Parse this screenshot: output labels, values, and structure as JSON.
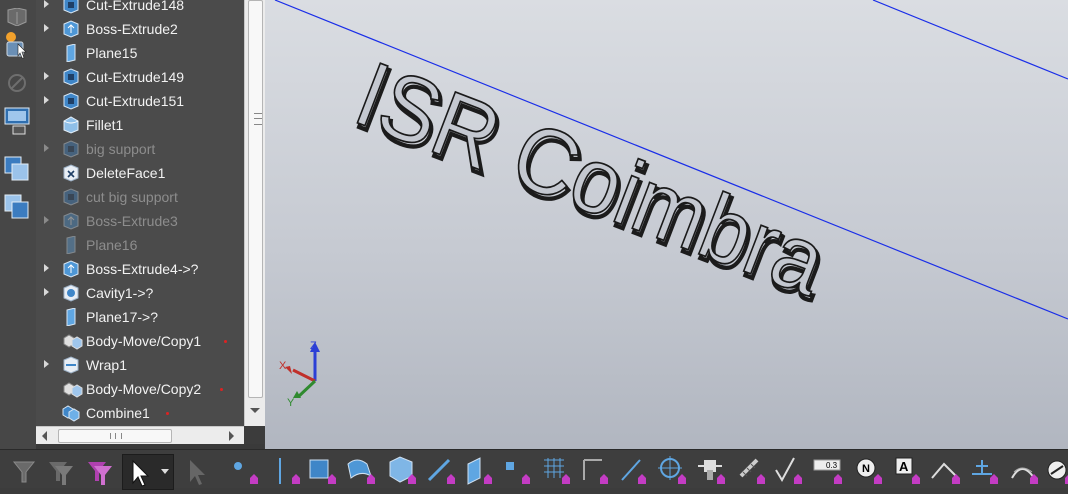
{
  "feature_tree": {
    "items": [
      {
        "label": "Cut-Extrude148",
        "icon": "cut-extrude-icon",
        "expandable": true,
        "dim": false,
        "marker": false
      },
      {
        "label": "Boss-Extrude2",
        "icon": "boss-extrude-icon",
        "expandable": true,
        "dim": false,
        "marker": false
      },
      {
        "label": "Plane15",
        "icon": "plane-icon",
        "expandable": false,
        "dim": false,
        "marker": false
      },
      {
        "label": "Cut-Extrude149",
        "icon": "cut-extrude-icon",
        "expandable": true,
        "dim": false,
        "marker": false
      },
      {
        "label": "Cut-Extrude151",
        "icon": "cut-extrude-icon",
        "expandable": true,
        "dim": false,
        "marker": false
      },
      {
        "label": "Fillet1",
        "icon": "fillet-icon",
        "expandable": false,
        "dim": false,
        "marker": false
      },
      {
        "label": "big support",
        "icon": "cut-extrude-icon",
        "expandable": true,
        "dim": true,
        "marker": false
      },
      {
        "label": "DeleteFace1",
        "icon": "delete-face-icon",
        "expandable": false,
        "dim": false,
        "marker": false
      },
      {
        "label": "cut big support",
        "icon": "cut-extrude-icon",
        "expandable": false,
        "dim": true,
        "marker": false
      },
      {
        "label": "Boss-Extrude3",
        "icon": "boss-extrude-icon",
        "expandable": true,
        "dim": true,
        "marker": false
      },
      {
        "label": "Plane16",
        "icon": "plane-icon",
        "expandable": false,
        "dim": true,
        "marker": false
      },
      {
        "label": "Boss-Extrude4->?",
        "icon": "boss-extrude-icon",
        "expandable": true,
        "dim": false,
        "marker": false
      },
      {
        "label": "Cavity1->?",
        "icon": "cavity-icon",
        "expandable": true,
        "dim": false,
        "marker": false
      },
      {
        "label": "Plane17->?",
        "icon": "plane-icon",
        "expandable": false,
        "dim": false,
        "marker": false
      },
      {
        "label": "Body-Move/Copy1",
        "icon": "body-move-icon",
        "expandable": false,
        "dim": false,
        "marker": true
      },
      {
        "label": "Wrap1",
        "icon": "wrap-icon",
        "expandable": true,
        "dim": false,
        "marker": false
      },
      {
        "label": "Body-Move/Copy2",
        "icon": "body-move-icon",
        "expandable": false,
        "dim": false,
        "marker": true
      },
      {
        "label": "Combine1",
        "icon": "combine-icon",
        "expandable": false,
        "dim": false,
        "marker": true
      }
    ]
  },
  "viewport": {
    "engraved_text": "ISR Coimbra",
    "triad": {
      "x": "X",
      "y": "Y",
      "z": "Z"
    },
    "colors": {
      "sketch_line": "#1a2ee8",
      "triad_x": "#c0302a",
      "triad_y": "#2f8a2f",
      "triad_z": "#2b3fd6"
    }
  },
  "left_toolbar": {
    "icons": [
      "view-box-icon",
      "appearance-icon",
      "edit-appearance-icon",
      "display-pane-icon",
      "copy-window-icon",
      "paste-window-icon"
    ]
  },
  "bottom_toolbar": {
    "icons": [
      "filter-icon",
      "filter-toggle-icon",
      "filter-selection-icon",
      "select-arrow-icon",
      "select-other-icon",
      "point-icon",
      "axis-line-icon",
      "face-icon",
      "surface-icon",
      "solid-body-icon",
      "edge-icon",
      "plane-filter-icon",
      "vertex-icon",
      "grid-icon",
      "corner-icon",
      "sketch-segment-icon",
      "center-mark-icon",
      "dimension-icon",
      "cosmetic-thread-icon",
      "surface-finish-icon",
      "dimension-value-icon",
      "note-icon",
      "datum-feature-icon",
      "geometric-tolerance-icon",
      "datum-target-icon",
      "weld-symbol-icon",
      "weld-bead-icon",
      "hole-callout-icon",
      "more-icon"
    ],
    "dimension_value_text": "0.3",
    "note_text": "A",
    "datum_text": "N"
  }
}
